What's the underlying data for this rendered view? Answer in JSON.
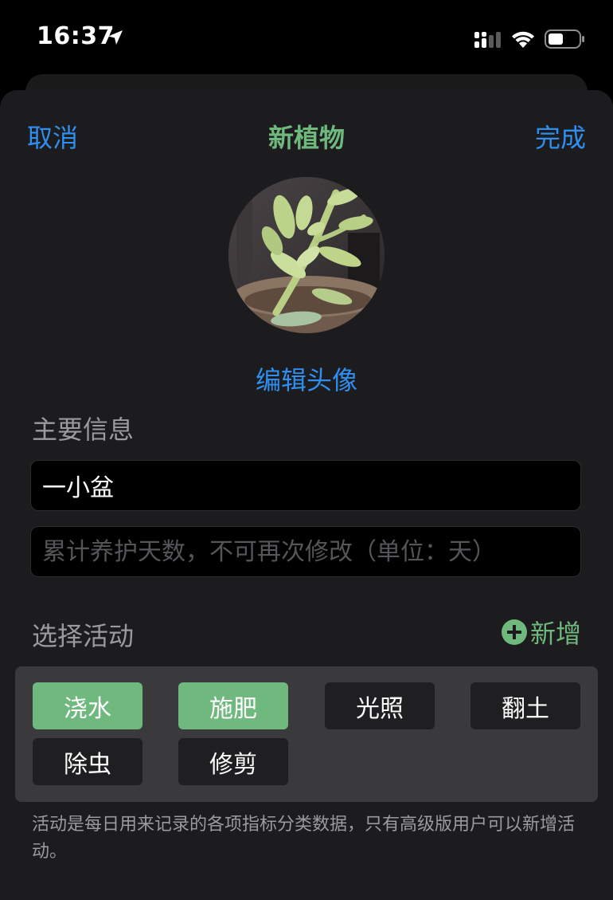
{
  "status_bar": {
    "time": "16:37"
  },
  "nav": {
    "cancel_label": "取消",
    "title": "新植物",
    "done_label": "完成"
  },
  "avatar": {
    "edit_label": "编辑头像"
  },
  "main_info": {
    "section_label": "主要信息",
    "name_value": "一小盆",
    "days_placeholder": "累计养护天数，不可再次修改（单位：天）"
  },
  "activities": {
    "section_label": "选择活动",
    "add_label": "新增",
    "items": [
      {
        "label": "浇水",
        "selected": true
      },
      {
        "label": "施肥",
        "selected": true
      },
      {
        "label": "光照",
        "selected": false
      },
      {
        "label": "翻土",
        "selected": false
      },
      {
        "label": "除虫",
        "selected": false
      },
      {
        "label": "修剪",
        "selected": false
      }
    ],
    "footnote": "活动是每日用来记录的各项指标分类数据，只有高级版用户可以新增活动。"
  },
  "colors": {
    "accent_blue": "#2f8ff0",
    "accent_green": "#6fb97e",
    "sheet_bg": "#1c1c1e",
    "panel_bg": "#3a3a3c"
  },
  "icons": [
    "location-arrow-icon",
    "cellular-signal-icon",
    "wifi-icon",
    "battery-icon",
    "plus-circle-icon"
  ]
}
